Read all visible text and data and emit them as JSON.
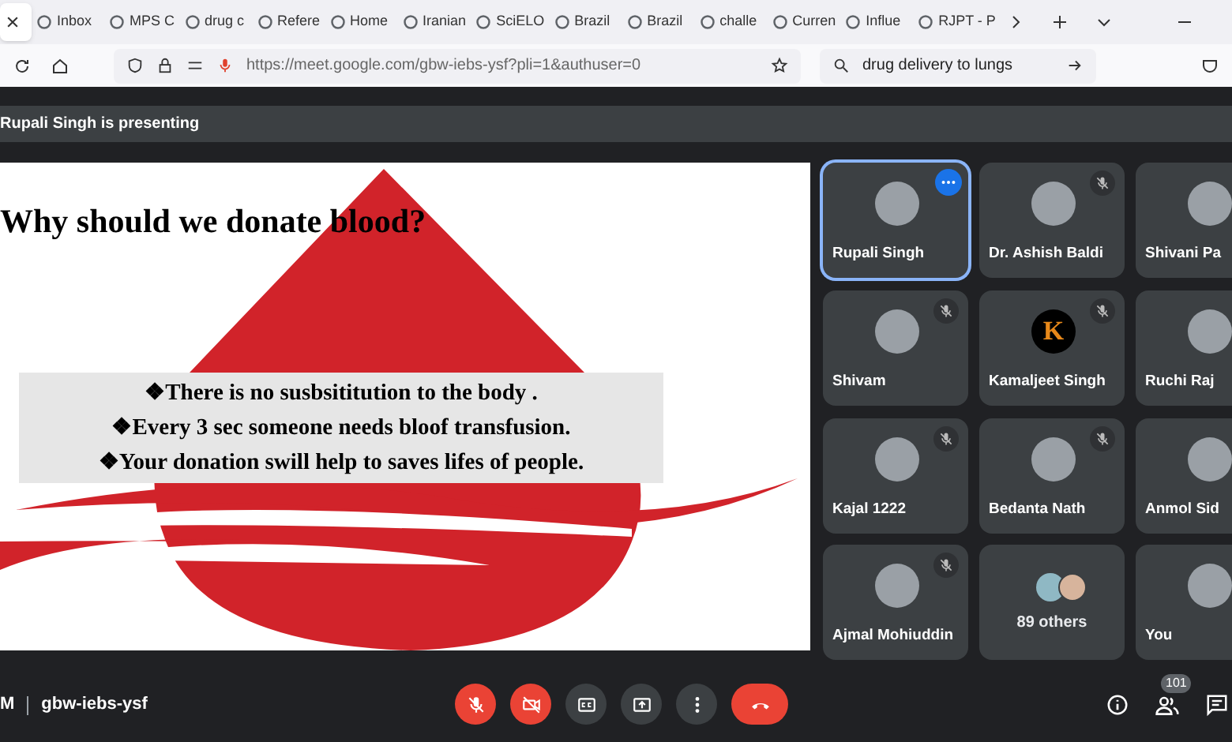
{
  "browser": {
    "tabs": [
      {
        "selected": true
      },
      {
        "label": "Inbox",
        "selected": false
      },
      {
        "label": "MPS C",
        "selected": false
      },
      {
        "label": "drug c",
        "selected": false
      },
      {
        "label": "Refere",
        "selected": false
      },
      {
        "label": "Home",
        "selected": false
      },
      {
        "label": "Iranian",
        "selected": false
      },
      {
        "label": "SciELO",
        "selected": false
      },
      {
        "label": "Brazil",
        "selected": false
      },
      {
        "label": "Brazil",
        "selected": false
      },
      {
        "label": "challe",
        "selected": false
      },
      {
        "label": "Curren",
        "selected": false
      },
      {
        "label": "Influe",
        "selected": false
      },
      {
        "label": "RJPT - P",
        "selected": false
      }
    ],
    "address": "https://meet.google.com/gbw-iebs-ysf?pli=1&authuser=0",
    "search": "drug delivery to lungs"
  },
  "meeting": {
    "presenting": "Rupali Singh is presenting",
    "slide": {
      "title": "**Why should we donate blood**?",
      "bullets": [
        "❖There is no susbsititution to the body .",
        "❖Every 3 sec someone needs bloof transfusion.",
        "❖Your donation swill help to saves lifes of people."
      ]
    },
    "tiles": [
      {
        "kind": "person",
        "name": "Rupali Singh",
        "muted": false,
        "selected": true
      },
      {
        "kind": "person",
        "name": "Dr. Ashish Baldi",
        "muted": true,
        "selected": false
      },
      {
        "kind": "person",
        "name": "Shivani Pa",
        "muted": false,
        "selected": false
      },
      {
        "kind": "person",
        "name": "Shivam",
        "muted": true,
        "selected": false
      },
      {
        "kind": "person",
        "name": "Kamaljeet Singh",
        "muted": true,
        "selected": false,
        "initial": "K"
      },
      {
        "kind": "person",
        "name": "Ruchi Raj",
        "muted": false,
        "selected": false
      },
      {
        "kind": "person",
        "name": "Kajal 1222",
        "muted": true,
        "selected": false
      },
      {
        "kind": "person",
        "name": "Bedanta Nath",
        "muted": true,
        "selected": false
      },
      {
        "kind": "person",
        "name": "Anmol Sid",
        "muted": false,
        "selected": false
      },
      {
        "kind": "person",
        "name": "Ajmal Mohiuddin",
        "muted": true,
        "selected": false
      },
      {
        "kind": "others",
        "name": "89 others",
        "muted": false,
        "selected": false
      },
      {
        "kind": "person",
        "name": "You",
        "muted": false,
        "selected": false
      }
    ],
    "bottom": {
      "time": "M",
      "code": "gbw-iebs-ysf",
      "people_count": "101"
    }
  }
}
